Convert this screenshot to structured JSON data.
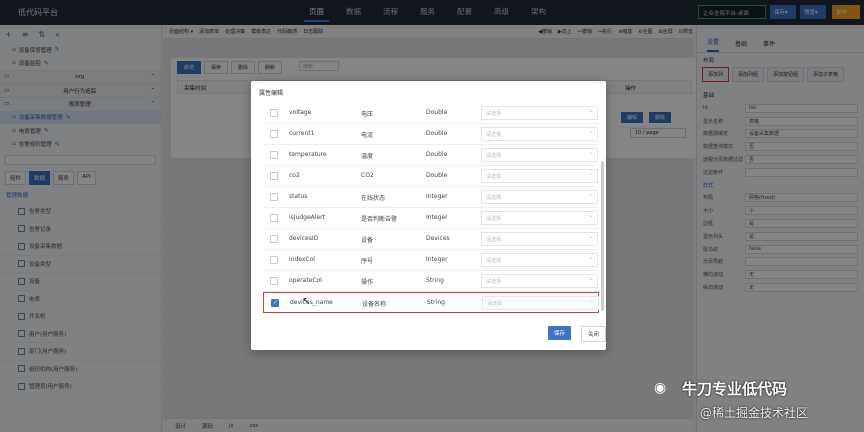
{
  "app": {
    "title": "低代码平台"
  },
  "top_nav": [
    "页面",
    "数据",
    "流程",
    "服务",
    "配置",
    "高级",
    "架构"
  ],
  "top_right": {
    "env": "企业全局平台-桌面",
    "save": "保存▾",
    "preview": "预览▾",
    "publish": "发布"
  },
  "tree": {
    "items": [
      {
        "label": "设备保修管理",
        "type": "item"
      },
      {
        "label": "设备监控",
        "type": "item"
      },
      {
        "label": "org",
        "type": "group"
      },
      {
        "label": "用户行为追踪",
        "type": "group"
      },
      {
        "label": "报表管理",
        "type": "group"
      },
      {
        "label": "设备采集数据管理",
        "type": "selected"
      },
      {
        "label": "电表管理",
        "type": "item"
      },
      {
        "label": "告警规则管理",
        "type": "item"
      }
    ],
    "side_tabs": [
      "组件",
      "数据",
      "服务",
      "API"
    ],
    "side_tab_active": "数据",
    "comp_head": "管理数据",
    "comp_items": [
      "告警类型",
      "告警记录",
      "设备采集数据",
      "设备类型",
      "设备",
      "电表",
      "开关柜",
      "用户(用户服务)",
      "部门(用户服务)",
      "组织机构(用户服务)",
      "管理员(用户服务)"
    ]
  },
  "center": {
    "toolbar": [
      "页面结构 ▾",
      "添加表单",
      "处理决策",
      "模板表达",
      "代码触感",
      "日志跟踪",
      "◀撤销",
      "▶向上",
      "↩撤销",
      "↪执行",
      "⊕缩放",
      "⊖全图",
      "⊞全屏",
      "⊟预览"
    ],
    "canvas_buttons": [
      "新增",
      "保存",
      "删除",
      "刷新"
    ],
    "search_placeholder": "搜索",
    "column": "采集时间",
    "ops": "操作",
    "row_btn1": "编辑",
    "row_btn2": "删除",
    "pager": "10 / page",
    "bottom_tabs": [
      "设计",
      "源码",
      "js",
      "css"
    ]
  },
  "right": {
    "tabs": [
      "设置",
      "基础",
      "事件"
    ],
    "section_layout": "布局",
    "buttons": [
      "添加列",
      "添加列组",
      "添加按钮组",
      "添加子表格"
    ],
    "basic_head": "基础",
    "props": [
      {
        "k": "Id",
        "v": "list"
      },
      {
        "k": "显示名称",
        "v": "表格"
      },
      {
        "k": "数据源绑定",
        "v": "设备采集数据"
      },
      {
        "k": "数据查询模式",
        "v": "否"
      },
      {
        "k": "远程分页数据过滤",
        "v": "否"
      },
      {
        "k": "过滤条件",
        "v": ""
      },
      {
        "k": "样式",
        "v": "",
        "sec": true
      },
      {
        "k": "布局",
        "v": "网格(fixed)"
      },
      {
        "k": "大小",
        "v": "小"
      },
      {
        "k": "边框",
        "v": "是"
      },
      {
        "k": "显示列头",
        "v": "是"
      },
      {
        "k": "斑马纹",
        "v": "false"
      },
      {
        "k": "分页导航",
        "v": ""
      },
      {
        "k": "横向滚动",
        "v": "无"
      },
      {
        "k": "纵向滚动",
        "v": "无"
      }
    ]
  },
  "dialog": {
    "title": "属性编辑",
    "rows": [
      {
        "name": "voltage",
        "label": "电压",
        "type": "Double",
        "checked": false,
        "highlight": false
      },
      {
        "name": "current1",
        "label": "电流",
        "type": "Double",
        "checked": false,
        "highlight": false
      },
      {
        "name": "temperature",
        "label": "温度",
        "type": "Double",
        "checked": false,
        "highlight": false
      },
      {
        "name": "co2",
        "label": "CO2",
        "type": "Double",
        "checked": false,
        "highlight": false
      },
      {
        "name": "status",
        "label": "在线状态",
        "type": "Integer",
        "checked": false,
        "highlight": false
      },
      {
        "name": "isJudgeAlert",
        "label": "是否判断告警",
        "type": "Integer",
        "checked": false,
        "highlight": false
      },
      {
        "name": "devicesID",
        "label": "设备",
        "type": "Devices",
        "checked": false,
        "highlight": false
      },
      {
        "name": "indexCol",
        "label": "序号",
        "type": "Integer",
        "checked": false,
        "highlight": false
      },
      {
        "name": "operateCol",
        "label": "操作",
        "type": "String",
        "checked": false,
        "highlight": false
      },
      {
        "name": "devices_name",
        "label": "设备名称",
        "type": "String",
        "checked": true,
        "highlight": true
      }
    ],
    "select_placeholder": "请选择",
    "confirm": "保存",
    "close": "关闭"
  },
  "watermark": {
    "line1": "牛刀专业低代码",
    "line2": "@稀土掘金技术社区"
  }
}
